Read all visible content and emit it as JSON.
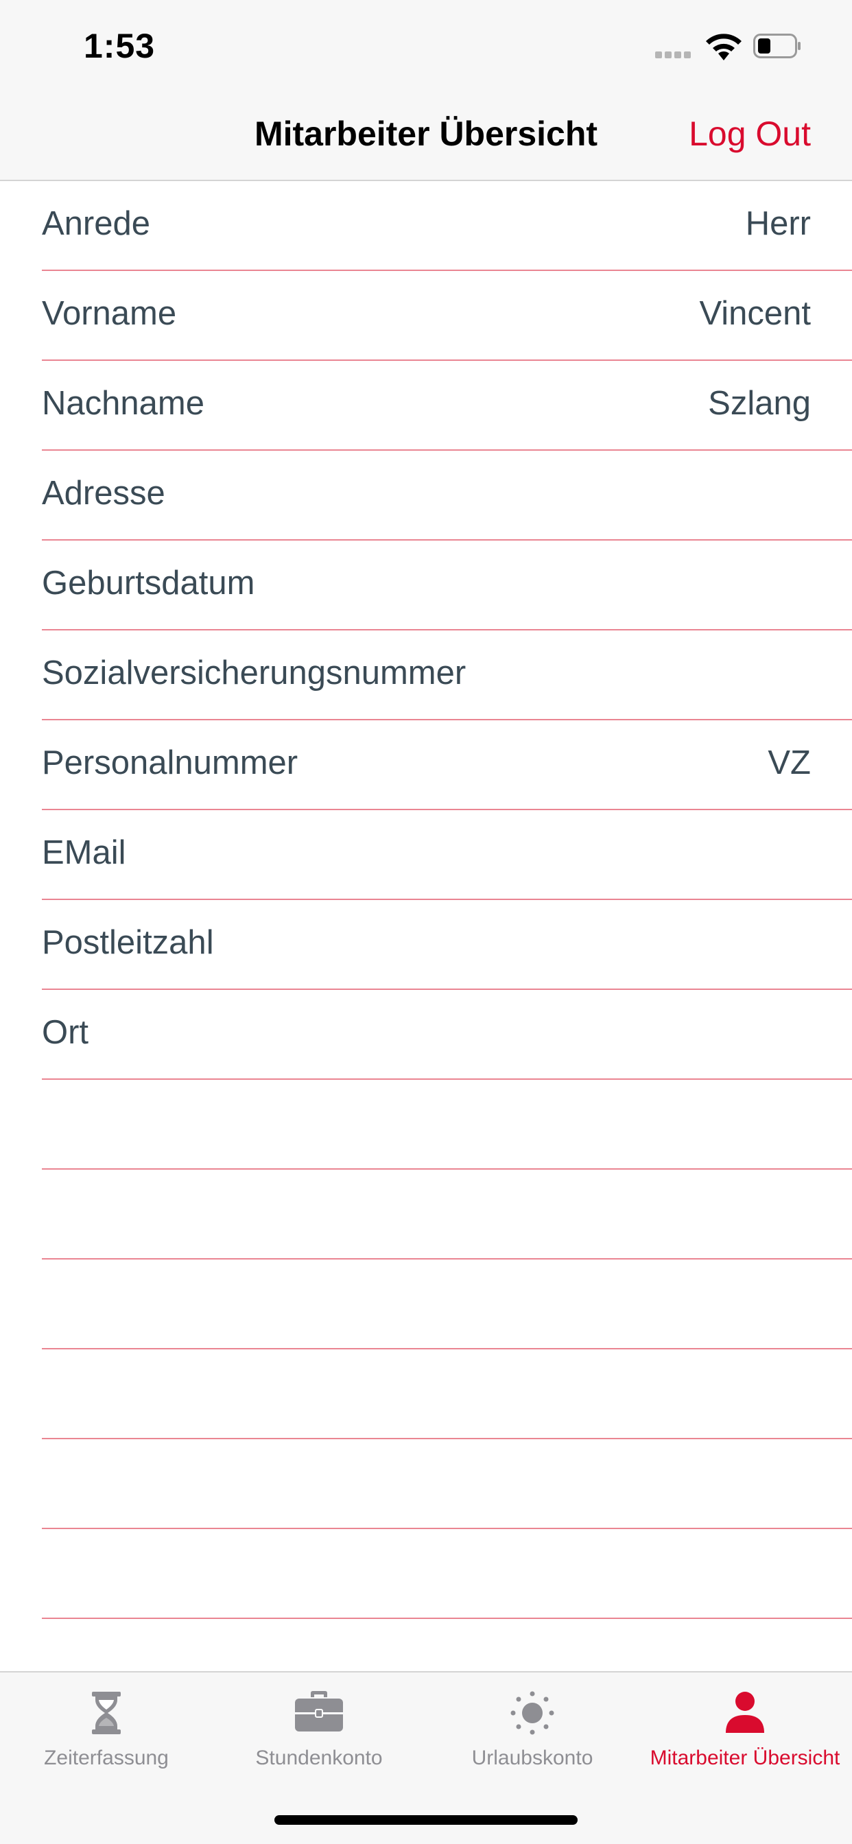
{
  "status_bar": {
    "time": "1:53"
  },
  "nav": {
    "title": "Mitarbeiter Übersicht",
    "logout_label": "Log Out"
  },
  "rows": [
    {
      "label": "Anrede",
      "value": "Herr"
    },
    {
      "label": "Vorname",
      "value": "Vincent"
    },
    {
      "label": "Nachname",
      "value": "Szlang"
    },
    {
      "label": "Adresse",
      "value": ""
    },
    {
      "label": "Geburtsdatum",
      "value": ""
    },
    {
      "label": "Sozialversicherungsnummer",
      "value": ""
    },
    {
      "label": "Personalnummer",
      "value": "VZ"
    },
    {
      "label": "EMail",
      "value": ""
    },
    {
      "label": "Postleitzahl",
      "value": ""
    },
    {
      "label": "Ort",
      "value": ""
    }
  ],
  "tabs": [
    {
      "label": "Zeiterfassung",
      "icon": "hourglass-icon",
      "active": false
    },
    {
      "label": "Stundenkonto",
      "icon": "briefcase-icon",
      "active": false
    },
    {
      "label": "Urlaubskonto",
      "icon": "sun-icon",
      "active": false
    },
    {
      "label": "Mitarbeiter Übersicht",
      "icon": "person-icon",
      "active": true
    }
  ],
  "colors": {
    "accent": "#d90b2e",
    "separator": "#ea8592",
    "text": "#3a4a55",
    "inactive": "#8e8e93"
  }
}
